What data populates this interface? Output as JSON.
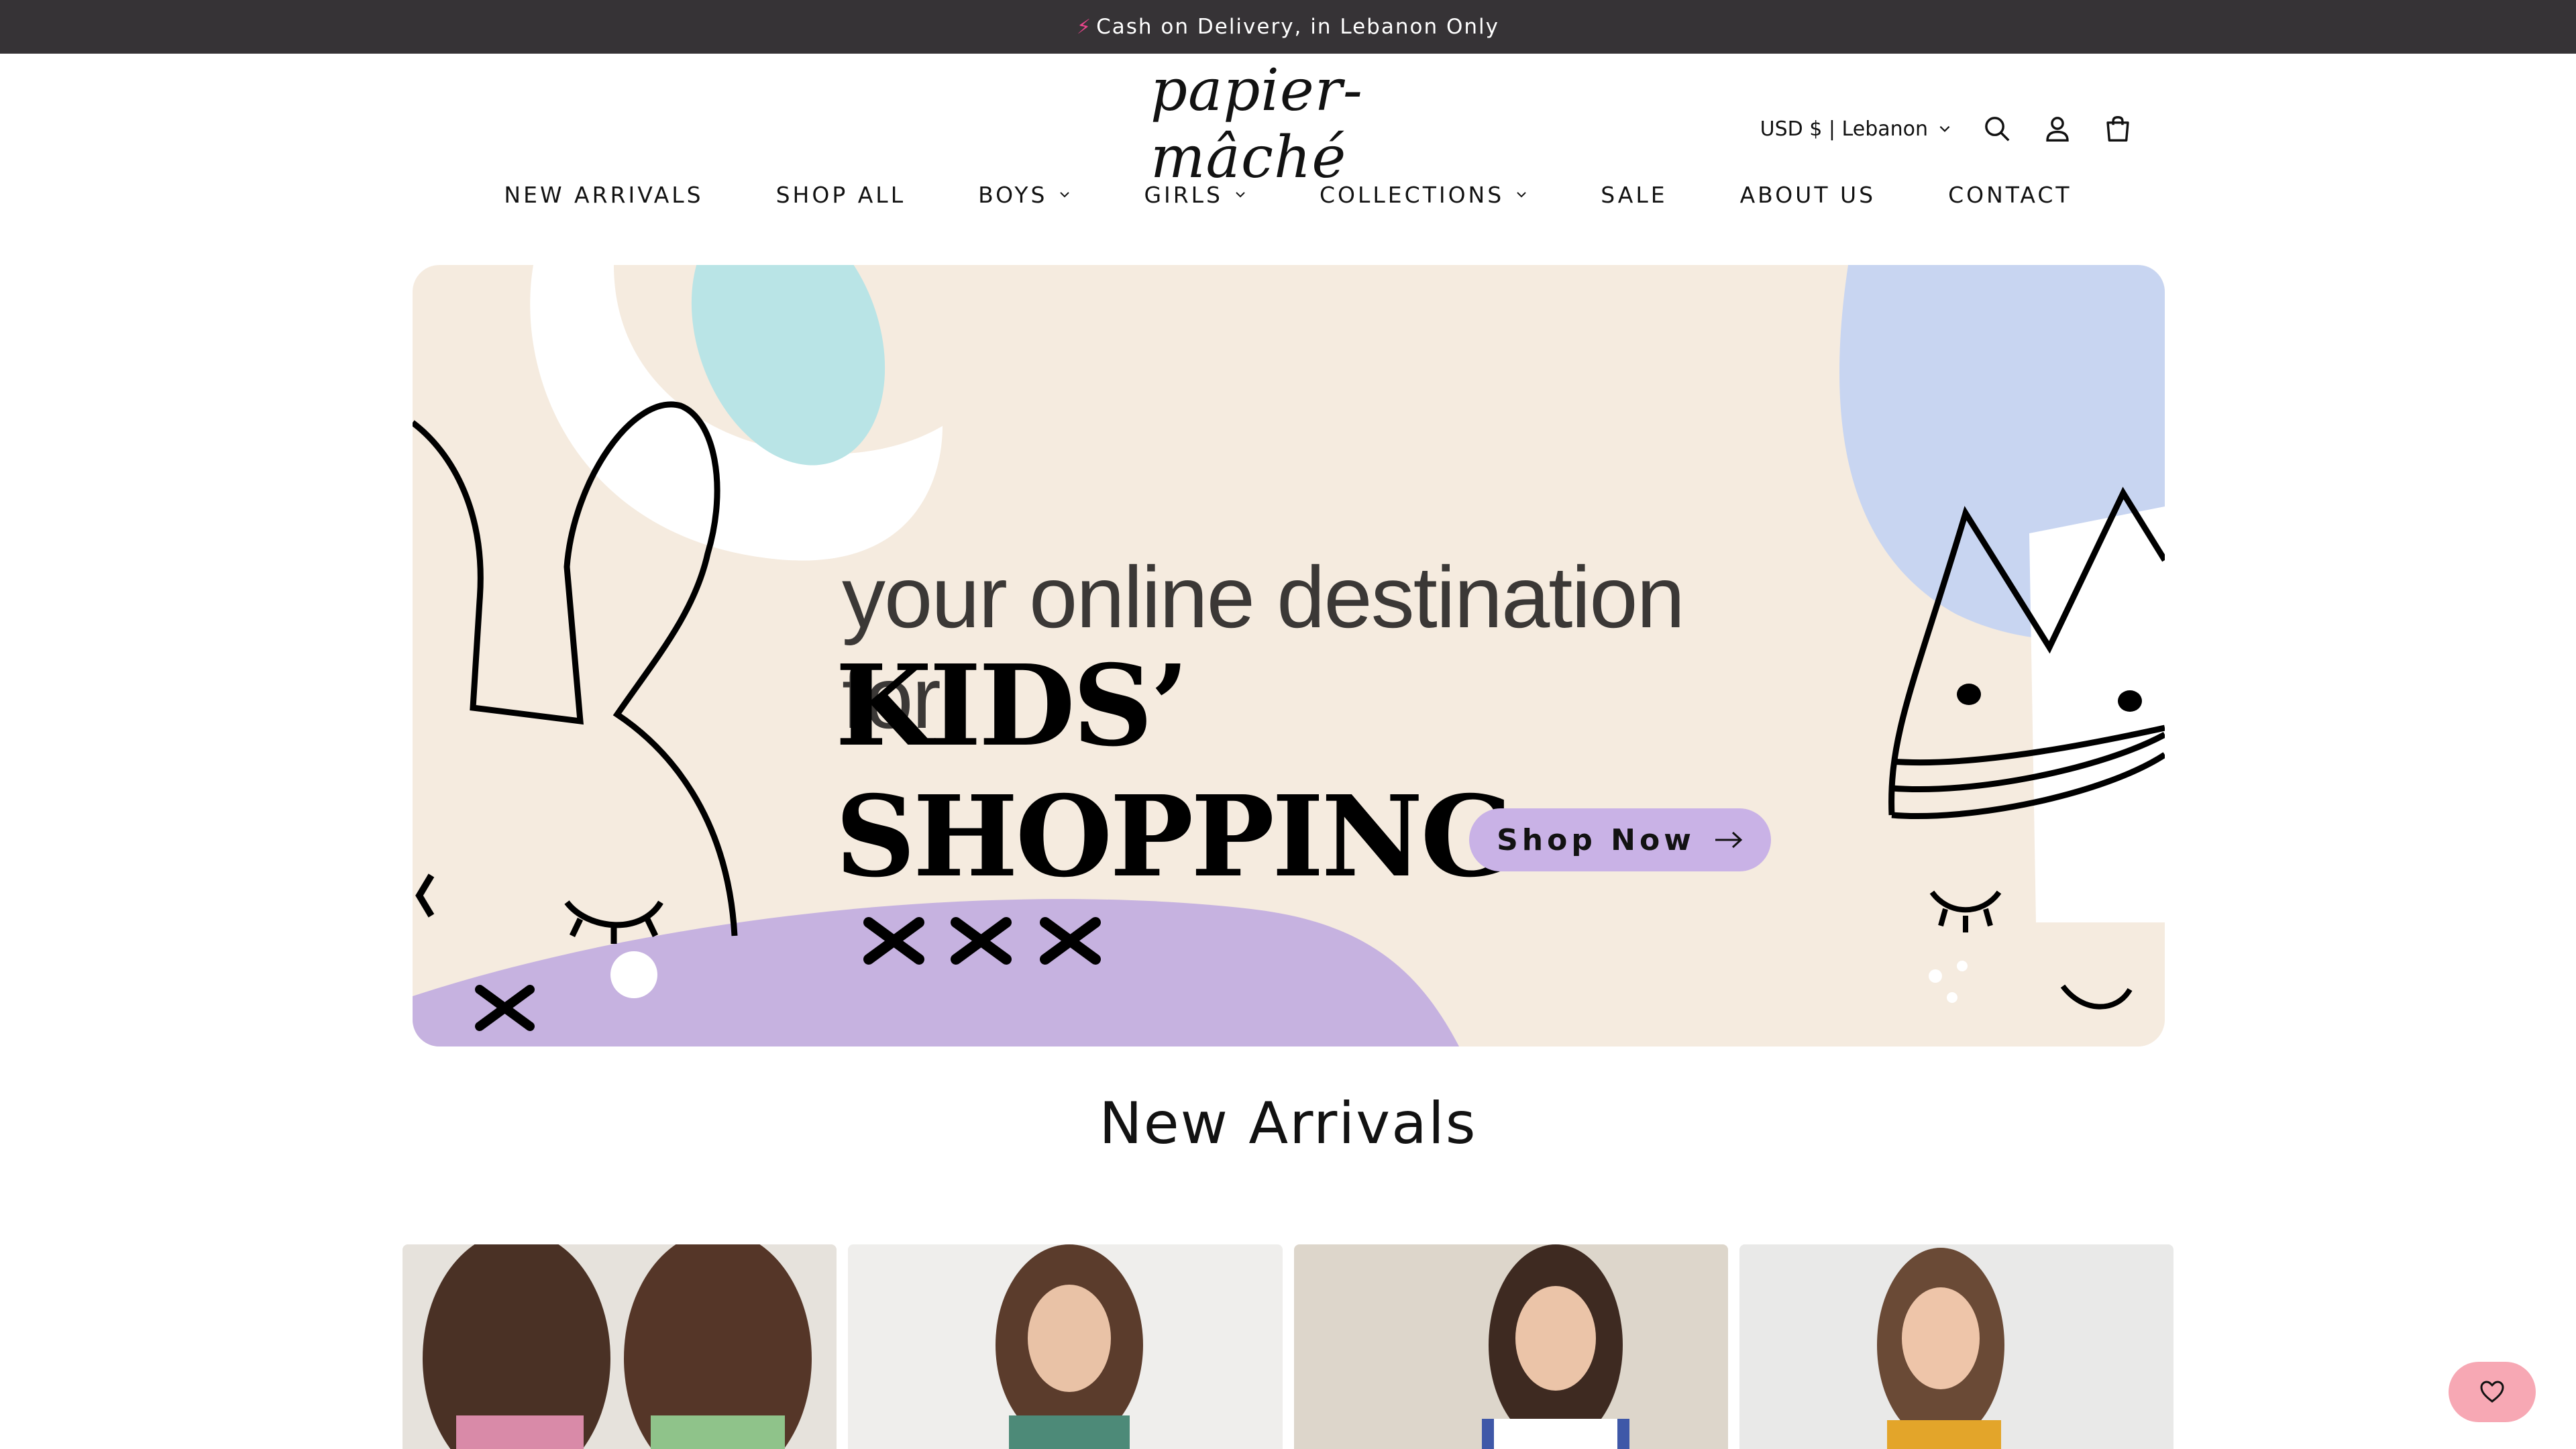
{
  "announcement": {
    "icon": "lightning-icon",
    "text": "Cash on Delivery, in Lebanon Only"
  },
  "header": {
    "logo_text": "papier-mâché",
    "currency": "USD $ | Lebanon",
    "icons": [
      "search-icon",
      "account-icon",
      "cart-icon"
    ]
  },
  "nav": {
    "items": [
      {
        "label": "NEW ARRIVALS",
        "dropdown": false
      },
      {
        "label": "SHOP ALL",
        "dropdown": false
      },
      {
        "label": "BOYS",
        "dropdown": true
      },
      {
        "label": "GIRLS",
        "dropdown": true
      },
      {
        "label": "COLLECTIONS",
        "dropdown": true
      },
      {
        "label": "SALE",
        "dropdown": false
      },
      {
        "label": "ABOUT US",
        "dropdown": false
      },
      {
        "label": "CONTACT",
        "dropdown": false
      }
    ]
  },
  "hero": {
    "line1": "your online destination for",
    "line2": "KIDS’ SHOPPING",
    "cta_label": "Shop Now",
    "colors": {
      "background": "#f5ebdf",
      "purple": "#c9b2e6",
      "teal": "#b9e4e6",
      "blue": "#c8d5f1"
    }
  },
  "new_arrivals": {
    "title": "New Arrivals"
  },
  "wishlist": {
    "icon": "heart-icon",
    "color": "#f7a8b4"
  }
}
